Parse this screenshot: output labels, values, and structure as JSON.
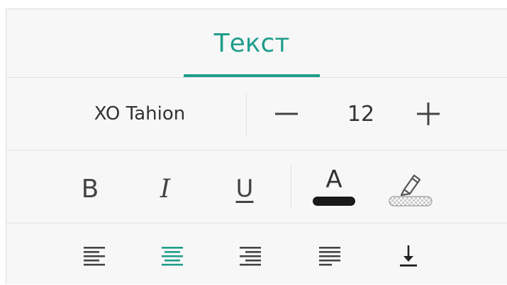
{
  "tabs": [
    {
      "label": "Текст",
      "active": true
    }
  ],
  "font": {
    "name": "XO Tahion"
  },
  "size": {
    "value": "12",
    "decrease_icon": "minus-icon",
    "increase_icon": "plus-icon"
  },
  "format": {
    "bold_label": "B",
    "italic_label": "I",
    "underline_label": "U",
    "font_color_label": "A",
    "font_color_icon": "font-color-icon",
    "highlight_icon": "highlighter-icon",
    "font_color": "#1a1a1a"
  },
  "paragraph": {
    "align_left_icon": "align-left-icon",
    "align_center_icon": "align-center-icon",
    "align_right_icon": "align-right-icon",
    "justify_icon": "align-justify-icon",
    "valign_bottom_icon": "valign-bottom-icon",
    "active_alignment": "center"
  },
  "colors": {
    "accent": "#1f9e8b",
    "icon": "#444444",
    "divider": "#e2e2e2",
    "panel": "#f7f7f7"
  }
}
